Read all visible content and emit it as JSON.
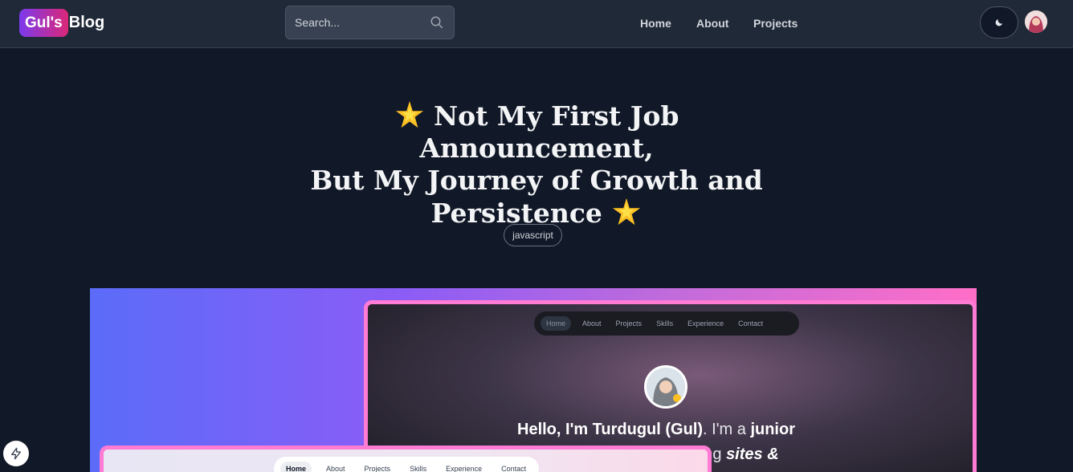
{
  "header": {
    "logo_badge": "Gul's",
    "logo_rest": "Blog",
    "search_placeholder": "Search...",
    "nav": [
      {
        "label": "Home"
      },
      {
        "label": "About"
      },
      {
        "label": "Projects"
      }
    ],
    "theme_icon": "moon-icon",
    "avatar_icon": "user-avatar"
  },
  "post": {
    "title_line1": "Not My First Job Announcement,",
    "title_line2": "But My Journey of Growth and",
    "title_line3": "Persistence",
    "title_emoji": "star-sparkle-icon",
    "tag": "javascript"
  },
  "hero_image": {
    "nav_items": [
      "Home",
      "About",
      "Projects",
      "Skills",
      "Experience",
      "Contact"
    ],
    "hello_plain1": "Hello, I'm ",
    "hello_bold_name": "Turdugul (Gul)",
    "hello_plain2": ". I'm a ",
    "hello_bold_junior": "junior",
    "hello_line2_plain": "y building ",
    "hello_line2_italic": "sites &",
    "colors": {
      "frame": "#ff7bd4",
      "gradient_start": "#5b6cf9",
      "gradient_end": "#ff6ec7"
    }
  },
  "floating": {
    "icon": "lightning-bolt-icon"
  },
  "colors": {
    "page_bg": "#111827",
    "header_bg": "#1f2937",
    "accent": "#db2777"
  }
}
